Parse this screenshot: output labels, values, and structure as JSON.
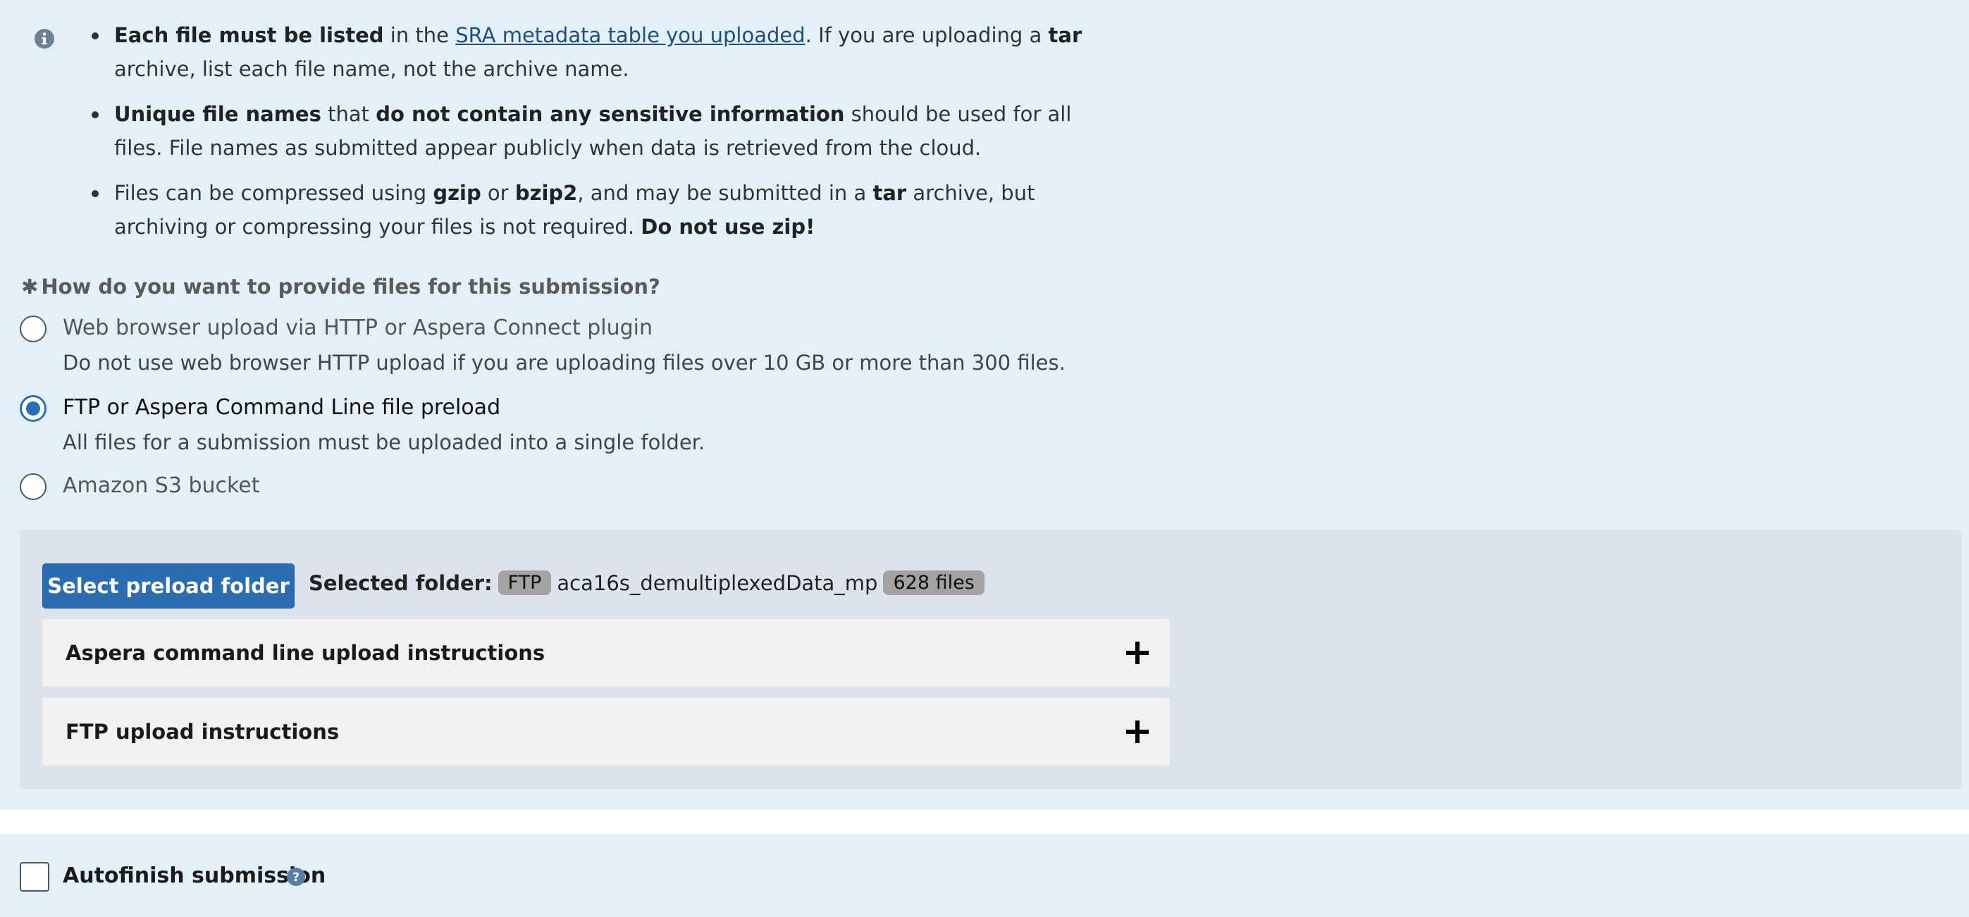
{
  "info": {
    "items": [
      [
        {
          "t": "Each file must be listed",
          "b": true
        },
        {
          "t": " in the "
        },
        {
          "t": "SRA metadata table you uploaded",
          "link": true
        },
        {
          "t": ". If you are uploading a "
        },
        {
          "t": "tar",
          "b": true
        },
        {
          "t": " archive, list each file name, not the archive name."
        }
      ],
      [
        {
          "t": "Unique file names",
          "b": true
        },
        {
          "t": " that "
        },
        {
          "t": "do not contain any sensitive information",
          "b": true
        },
        {
          "t": " should be used for all files. File names as submitted appear publicly when data is retrieved from the cloud."
        }
      ],
      [
        {
          "t": "Files can be compressed using "
        },
        {
          "t": "gzip",
          "b": true
        },
        {
          "t": " or "
        },
        {
          "t": "bzip2",
          "b": true
        },
        {
          "t": ", and may be submitted in a "
        },
        {
          "t": "tar",
          "b": true
        },
        {
          "t": " archive, but archiving or compressing your files is not required. "
        },
        {
          "t": "Do not use zip!",
          "b": true
        }
      ]
    ]
  },
  "question": {
    "star": "✱",
    "label": "How do you want to provide files for this submission?"
  },
  "options": [
    {
      "label": "Web browser upload via HTTP or Aspera Connect plugin",
      "sub": "Do not use web browser HTTP upload if you are uploading files over 10 GB or more than 300 files.",
      "checked": false
    },
    {
      "label": "FTP or Aspera Command Line file preload",
      "sub": "All files for a submission must be uploaded into a single folder.",
      "checked": true
    },
    {
      "label": "Amazon S3 bucket",
      "sub": "",
      "checked": false
    }
  ],
  "preload": {
    "button_label": "Select preload folder",
    "selected_label": "Selected folder:",
    "protocol_badge": "FTP",
    "folder_name": "aca16s_demultiplexedData_mp",
    "files_badge": "628 files",
    "accordions": [
      {
        "title": "Aspera command line upload instructions",
        "icon": "plus-icon"
      },
      {
        "title": "FTP upload instructions",
        "icon": "plus-icon"
      }
    ]
  },
  "autofinish": {
    "label": "Autofinish submission",
    "checked": false,
    "help_icon": "help-icon"
  },
  "colors": {
    "panel_bg": "#e3f0f7",
    "preload_bg": "#dde3ec",
    "primary_button": "#2a6db0",
    "radio_selected": "#2870b4",
    "badge_bg": "#a3a3a3",
    "link": "#1d4f86"
  }
}
